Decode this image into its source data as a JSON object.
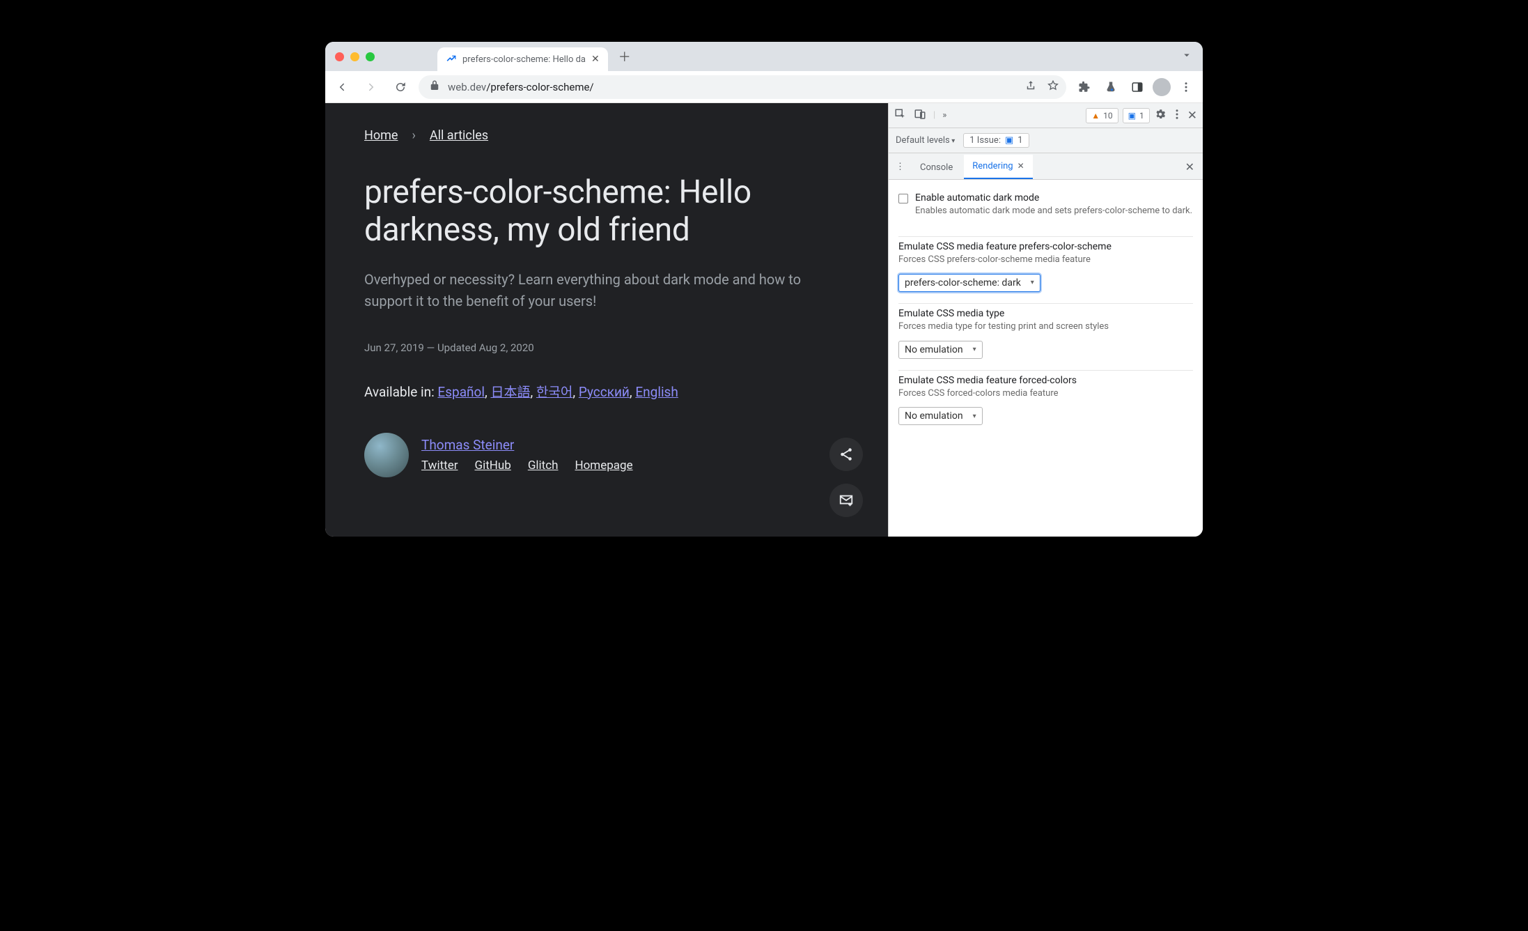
{
  "browser": {
    "tab_title": "prefers-color-scheme: Hello da",
    "url_host_prefix": "web.dev",
    "url_path": "/prefers-color-scheme/"
  },
  "page": {
    "breadcrumbs": {
      "home": "Home",
      "all": "All articles"
    },
    "title": "prefers-color-scheme: Hello darkness, my old friend",
    "subtitle": "Overhyped or necessity? Learn everything about dark mode and how to support it to the benefit of your users!",
    "dates": "Jun 27, 2019 — Updated Aug 2, 2020",
    "langs_label": "Available in:",
    "langs": {
      "es": "Español",
      "ja": "日本語",
      "ko": "한국어",
      "ru": "Русский",
      "en": "English"
    },
    "author": {
      "name": "Thomas Steiner",
      "links": {
        "twitter": "Twitter",
        "github": "GitHub",
        "glitch": "Glitch",
        "home": "Homepage"
      }
    }
  },
  "devtools": {
    "warnings_count": "10",
    "messages_count": "1",
    "levels_label": "Default levels",
    "issues_label": "1 Issue:",
    "issues_count": "1",
    "drawer_tabs": {
      "console": "Console",
      "rendering": "Rendering"
    },
    "sections": {
      "darkmode": {
        "title": "Enable automatic dark mode",
        "desc": "Enables automatic dark mode and sets prefers-color-scheme to dark."
      },
      "pcs": {
        "title": "Emulate CSS media feature prefers-color-scheme",
        "desc": "Forces CSS prefers-color-scheme media feature",
        "value": "prefers-color-scheme: dark"
      },
      "mediatype": {
        "title": "Emulate CSS media type",
        "desc": "Forces media type for testing print and screen styles",
        "value": "No emulation"
      },
      "forcedcolors": {
        "title": "Emulate CSS media feature forced-colors",
        "desc": "Forces CSS forced-colors media feature",
        "value": "No emulation"
      }
    }
  }
}
